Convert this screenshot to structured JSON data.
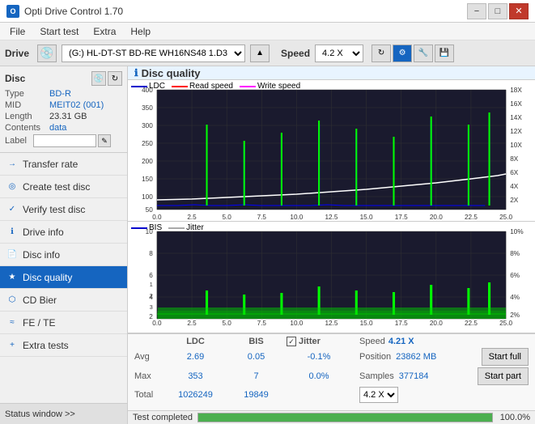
{
  "titleBar": {
    "title": "Opti Drive Control 1.70",
    "minimizeLabel": "−",
    "maximizeLabel": "□",
    "closeLabel": "✕"
  },
  "menuBar": {
    "items": [
      "File",
      "Start test",
      "Extra",
      "Help"
    ]
  },
  "driveBar": {
    "driveLabel": "Drive",
    "driveValue": "(G:) HL-DT-ST BD-RE  WH16NS48 1.D3",
    "speedLabel": "Speed",
    "speedValue": "4.2 X"
  },
  "disc": {
    "title": "Disc",
    "typeLabel": "Type",
    "typeValue": "BD-R",
    "midLabel": "MID",
    "midValue": "MEIT02 (001)",
    "lengthLabel": "Length",
    "lengthValue": "23.31 GB",
    "contentsLabel": "Contents",
    "contentsValue": "data",
    "labelLabel": "Label"
  },
  "nav": {
    "items": [
      {
        "id": "transfer-rate",
        "label": "Transfer rate",
        "icon": "→"
      },
      {
        "id": "create-test-disc",
        "label": "Create test disc",
        "icon": "◎"
      },
      {
        "id": "verify-test-disc",
        "label": "Verify test disc",
        "icon": "✓"
      },
      {
        "id": "drive-info",
        "label": "Drive info",
        "icon": "ℹ"
      },
      {
        "id": "disc-info",
        "label": "Disc info",
        "icon": "📀"
      },
      {
        "id": "disc-quality",
        "label": "Disc quality",
        "icon": "★",
        "active": true
      },
      {
        "id": "cd-bier",
        "label": "CD Bier",
        "icon": "🍺"
      },
      {
        "id": "fe-te",
        "label": "FE / TE",
        "icon": "≈"
      },
      {
        "id": "extra-tests",
        "label": "Extra tests",
        "icon": "+"
      }
    ],
    "statusWindow": "Status window >>"
  },
  "chart1": {
    "title": "Disc quality",
    "legend": {
      "ldc": "LDC",
      "readSpeed": "Read speed",
      "writeSpeed": "Write speed"
    },
    "yAxisMax": 400,
    "yAxisRight": [
      "18X",
      "16X",
      "14X",
      "12X",
      "10X",
      "8X",
      "6X",
      "4X",
      "2X"
    ],
    "xAxisMax": "25.0",
    "xAxisLabels": [
      "0.0",
      "2.5",
      "5.0",
      "7.5",
      "10.0",
      "12.5",
      "15.0",
      "17.5",
      "20.0",
      "22.5",
      "25.0"
    ]
  },
  "chart2": {
    "legend": {
      "bis": "BIS",
      "jitter": "Jitter"
    },
    "yAxisMax": 10,
    "yAxisRightLabels": [
      "10%",
      "8%",
      "6%",
      "4%",
      "2%"
    ],
    "xAxisMax": "25.0",
    "xAxisLabels": [
      "0.0",
      "2.5",
      "5.0",
      "7.5",
      "10.0",
      "12.5",
      "15.0",
      "17.5",
      "20.0",
      "22.5",
      "25.0"
    ]
  },
  "stats": {
    "jitterChecked": true,
    "jitterLabel": "Jitter",
    "speedLabel": "Speed",
    "speedValue": "4.21 X",
    "speedSelect": "4.2 X",
    "positionLabel": "Position",
    "positionValue": "23862 MB",
    "samplesLabel": "Samples",
    "samplesValue": "377184",
    "startFullLabel": "Start full",
    "startPartLabel": "Start part",
    "columns": {
      "ldc": "LDC",
      "bis": "BIS",
      "jitter": "Jitter"
    },
    "rows": {
      "avg": {
        "label": "Avg",
        "ldc": "2.69",
        "bis": "0.05",
        "jitter": "-0.1%"
      },
      "max": {
        "label": "Max",
        "ldc": "353",
        "bis": "7",
        "jitter": "0.0%"
      },
      "total": {
        "label": "Total",
        "ldc": "1026249",
        "bis": "19849",
        "jitter": ""
      }
    }
  },
  "progressBar": {
    "percent": 100,
    "label": "100.0%",
    "statusText": "Test completed"
  }
}
